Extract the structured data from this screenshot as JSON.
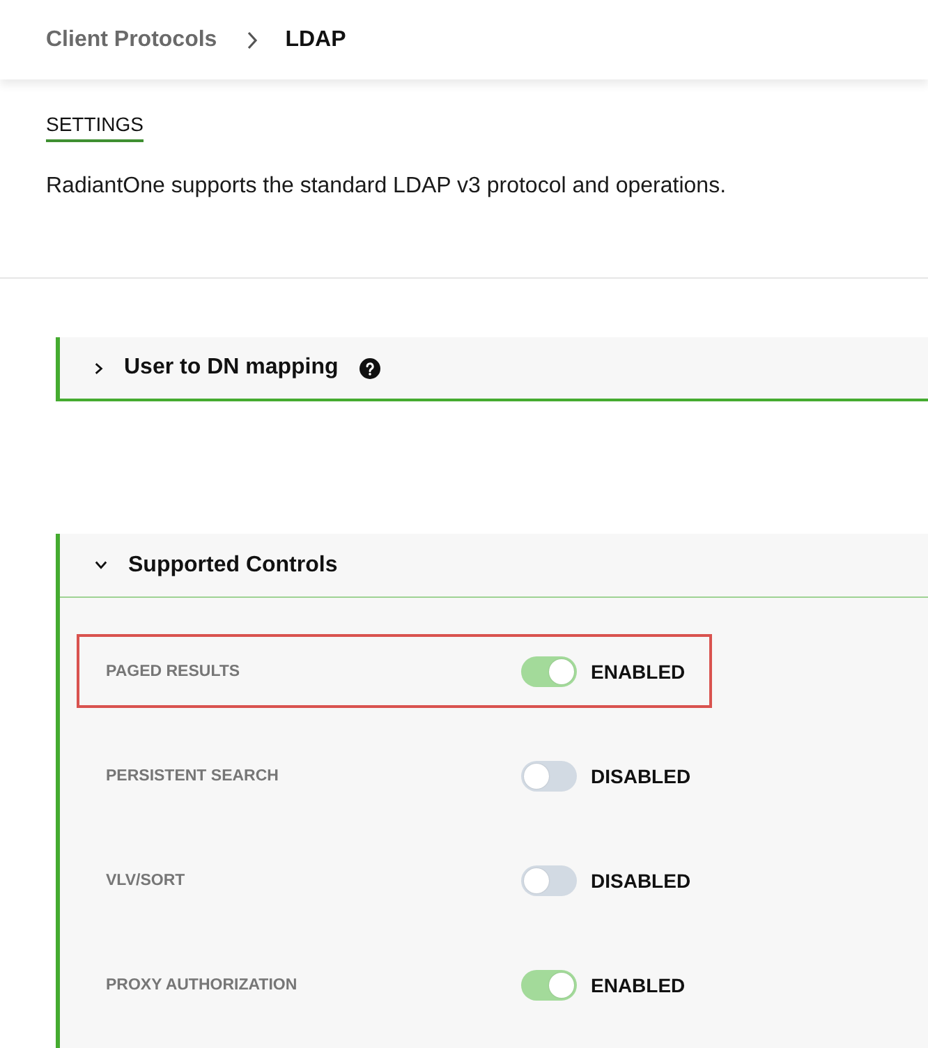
{
  "breadcrumb": [
    {
      "label": "Client Protocols",
      "current": false
    },
    {
      "label": "LDAP",
      "current": true
    }
  ],
  "tab": {
    "label": "SETTINGS",
    "selected": true
  },
  "description": "RadiantOne supports the standard LDAP v3 protocol and operations.",
  "sections": [
    {
      "title": "User to DN mapping",
      "expanded": false,
      "help": true
    },
    {
      "title": "Supported Controls",
      "expanded": true,
      "controls": [
        {
          "label": "PAGED RESULTS",
          "on": true,
          "status": "ENABLED",
          "highlighted": true
        },
        {
          "label": "PERSISTENT SEARCH",
          "on": false,
          "status": "DISABLED",
          "highlighted": false
        },
        {
          "label": "VLV/SORT",
          "on": false,
          "status": "DISABLED",
          "highlighted": false
        },
        {
          "label": "PROXY AUTHORIZATION",
          "on": true,
          "status": "ENABLED",
          "highlighted": false
        }
      ]
    }
  ]
}
